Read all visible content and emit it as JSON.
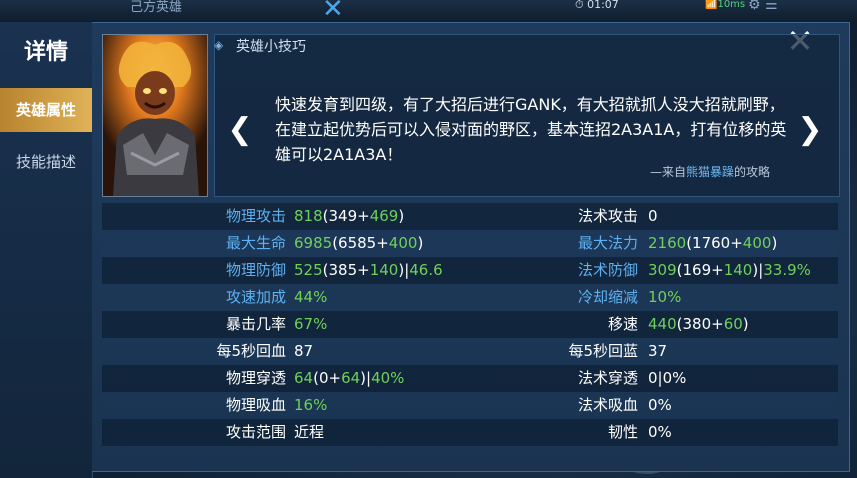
{
  "background": {
    "title": "己方英雄",
    "time": "01:07",
    "signal": "10ms"
  },
  "sidebar": {
    "title": "详情",
    "tabs": [
      {
        "label": "英雄属性",
        "active": true
      },
      {
        "label": "技能描述",
        "active": false
      }
    ]
  },
  "tips": {
    "title": "英雄小技巧",
    "text": "快速发育到四级，有了大招后进行GANK，有大招就抓人没大招就刷野，在建立起优势后可以入侵对面的野区，基本连招2A3A1A，打有位移的英雄可以2A1A3A！",
    "source_prefix": "—来自",
    "source_name": "熊猫暴躁",
    "source_suffix": "的攻略"
  },
  "stats": [
    {
      "left": {
        "label": "物理攻击",
        "label_color": "blue",
        "parts": [
          [
            "818",
            "green"
          ],
          [
            "(349+",
            "white"
          ],
          [
            "469",
            "green"
          ],
          [
            ")",
            "white"
          ]
        ]
      },
      "right": {
        "label": "法术攻击",
        "label_color": "white",
        "parts": [
          [
            "0",
            "white"
          ]
        ]
      }
    },
    {
      "left": {
        "label": "最大生命",
        "label_color": "blue",
        "parts": [
          [
            "6985",
            "green"
          ],
          [
            "(6585+",
            "white"
          ],
          [
            "400",
            "green"
          ],
          [
            ")",
            "white"
          ]
        ]
      },
      "right": {
        "label": "最大法力",
        "label_color": "blue",
        "parts": [
          [
            "2160",
            "green"
          ],
          [
            "(1760+",
            "white"
          ],
          [
            "400",
            "green"
          ],
          [
            ")",
            "white"
          ]
        ]
      }
    },
    {
      "left": {
        "label": "物理防御",
        "label_color": "blue",
        "parts": [
          [
            "525",
            "green"
          ],
          [
            "(385+",
            "white"
          ],
          [
            "140",
            "green"
          ],
          [
            ")|",
            "white"
          ],
          [
            "46.6",
            "green"
          ]
        ]
      },
      "right": {
        "label": "法术防御",
        "label_color": "blue",
        "parts": [
          [
            "309",
            "green"
          ],
          [
            "(169+",
            "white"
          ],
          [
            "140",
            "green"
          ],
          [
            ")|",
            "white"
          ],
          [
            "33.9%",
            "green"
          ]
        ]
      }
    },
    {
      "left": {
        "label": "攻速加成",
        "label_color": "blue",
        "parts": [
          [
            "44%",
            "green"
          ]
        ]
      },
      "right": {
        "label": "冷却缩减",
        "label_color": "blue",
        "parts": [
          [
            "10%",
            "green"
          ]
        ]
      }
    },
    {
      "left": {
        "label": "暴击几率",
        "label_color": "white",
        "parts": [
          [
            "67%",
            "green"
          ]
        ]
      },
      "right": {
        "label": "移速",
        "label_color": "white",
        "parts": [
          [
            "440",
            "green"
          ],
          [
            "(380+",
            "white"
          ],
          [
            "60",
            "green"
          ],
          [
            ")",
            "white"
          ]
        ]
      }
    },
    {
      "left": {
        "label": "每5秒回血",
        "label_color": "white",
        "parts": [
          [
            "87",
            "white"
          ]
        ]
      },
      "right": {
        "label": "每5秒回蓝",
        "label_color": "white",
        "parts": [
          [
            "37",
            "white"
          ]
        ]
      }
    },
    {
      "left": {
        "label": "物理穿透",
        "label_color": "white",
        "parts": [
          [
            "64",
            "green"
          ],
          [
            "(0+",
            "white"
          ],
          [
            "64",
            "green"
          ],
          [
            ")|",
            "white"
          ],
          [
            "40%",
            "green"
          ]
        ]
      },
      "right": {
        "label": "法术穿透",
        "label_color": "white",
        "parts": [
          [
            "0|0%",
            "white"
          ]
        ]
      }
    },
    {
      "left": {
        "label": "物理吸血",
        "label_color": "white",
        "parts": [
          [
            "16%",
            "green"
          ]
        ]
      },
      "right": {
        "label": "法术吸血",
        "label_color": "white",
        "parts": [
          [
            "0%",
            "white"
          ]
        ]
      }
    },
    {
      "left": {
        "label": "攻击范围",
        "label_color": "white",
        "parts": [
          [
            "近程",
            "white"
          ]
        ]
      },
      "right": {
        "label": "韧性",
        "label_color": "white",
        "parts": [
          [
            "0%",
            "white"
          ]
        ]
      }
    }
  ],
  "colors": {
    "blue": "#5fb0f0",
    "green": "#6fd05a",
    "gold": "#e0b257"
  },
  "icons": [
    "close-icon",
    "chevron-left-icon",
    "chevron-right-icon",
    "tips-marker-icon"
  ]
}
